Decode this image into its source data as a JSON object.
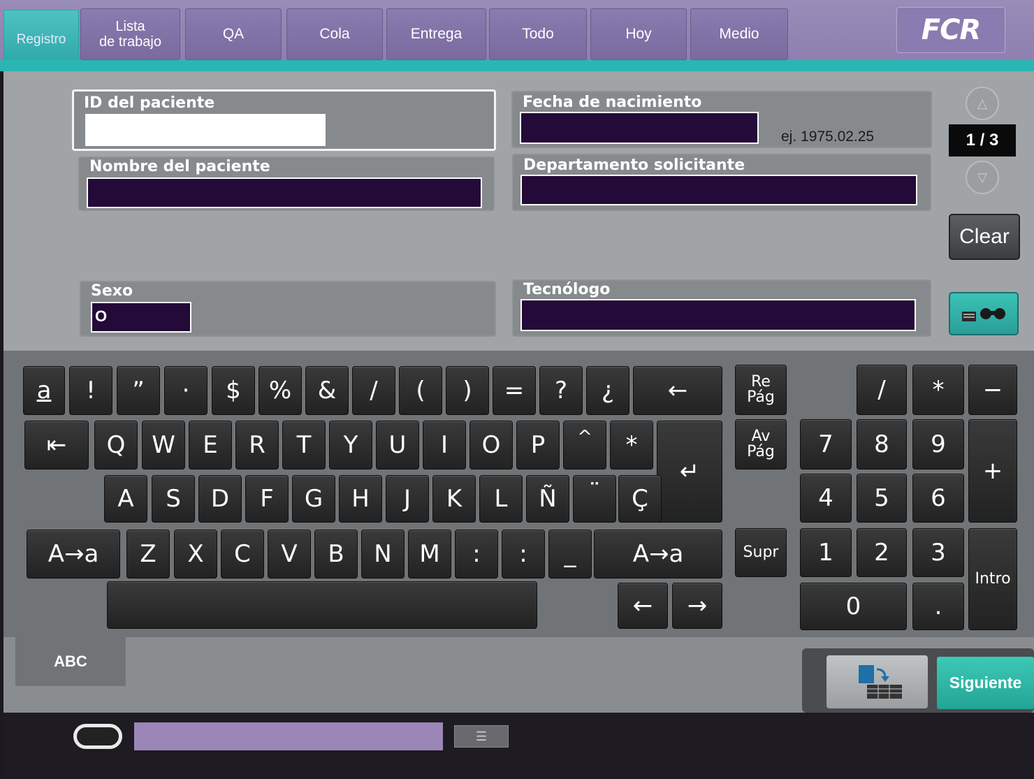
{
  "tabs": [
    {
      "label": "Registro",
      "active": true
    },
    {
      "label": "Lista\nde trabajo"
    },
    {
      "label": "QA"
    },
    {
      "label": "Cola"
    },
    {
      "label": "Entrega"
    },
    {
      "label": "Todo"
    },
    {
      "label": "Hoy"
    },
    {
      "label": "Medio"
    }
  ],
  "logo": "FCR",
  "form": {
    "patient_id_label": "ID del paciente",
    "patient_id_value": "",
    "birthdate_label": "Fecha de nacimiento",
    "birthdate_value": "",
    "birthdate_hint": "ej. 1975.02.25",
    "patient_name_label": "Nombre del paciente",
    "patient_name_value": "",
    "department_label": "Departamento solicitante",
    "department_value": "",
    "sex_label": "Sexo",
    "sex_value": "O",
    "technologist_label": "Tecnólogo",
    "technologist_value": ""
  },
  "pager": {
    "text": "1 / 3",
    "up": "△",
    "down": "▽"
  },
  "clear_label": "Clear",
  "keyboard": {
    "row1": [
      "a",
      "!",
      "”",
      "·",
      "$",
      "%",
      "&",
      "/",
      "(",
      ")",
      "=",
      "?",
      "¿",
      "←"
    ],
    "row2": [
      "⇤",
      "Q",
      "W",
      "E",
      "R",
      "T",
      "Y",
      "U",
      "I",
      "O",
      "P",
      "^",
      "*"
    ],
    "row3": [
      "A",
      "S",
      "D",
      "F",
      "G",
      "H",
      "J",
      "K",
      "L",
      "Ñ",
      "¨",
      "Ç"
    ],
    "row4": [
      "A→a",
      "Z",
      "X",
      "C",
      "V",
      "B",
      "N",
      "M",
      ":",
      ":",
      "_",
      "A→a"
    ],
    "enter": "↵",
    "space": "",
    "arrow_left": "←",
    "arrow_right": "→",
    "page_up": "Re\nPág",
    "page_down": "Av\nPág",
    "delete": "Supr",
    "numpad": {
      "slash": "/",
      "star": "*",
      "minus": "−",
      "plus": "+",
      "n7": "7",
      "n8": "8",
      "n9": "9",
      "n4": "4",
      "n5": "5",
      "n6": "6",
      "n1": "1",
      "n2": "2",
      "n3": "3",
      "n0": "0",
      "dot": ".",
      "intro": "Intro"
    }
  },
  "mode_tab": "ABC",
  "next_label": "Siguiente"
}
